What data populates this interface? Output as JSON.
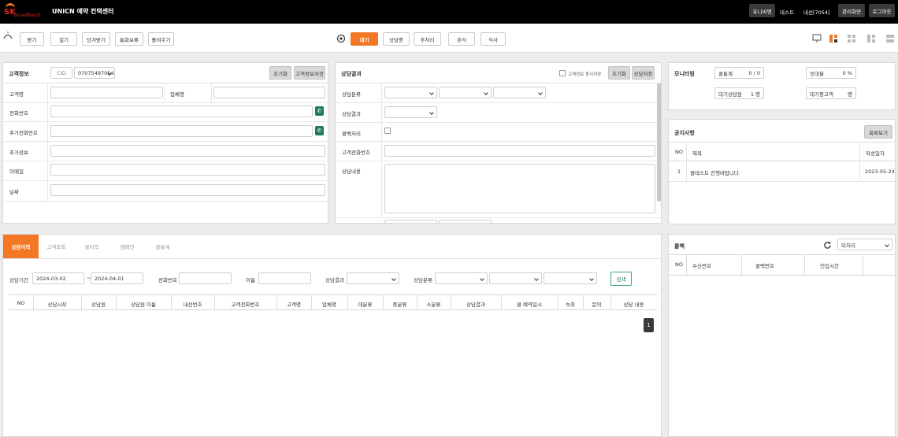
{
  "header": {
    "logo_text": "SK",
    "logo_sub": "broadband",
    "app_title": "UNICN 예약 컨택센터",
    "user_company": "유니씨엔",
    "user_name": "테스트",
    "extension": "내선[7054]",
    "admin_label": "관리화면",
    "logout_label": "로그아웃"
  },
  "toolbar": {
    "left_buttons": [
      "받기",
      "걸기",
      "당겨받기",
      "통화보류",
      "돌려주기"
    ],
    "status_buttons": [
      "대기",
      "상담중",
      "후처리",
      "휴식",
      "식사"
    ],
    "active_status": "대기"
  },
  "customer": {
    "title": "고객정보",
    "cid_label": "CID",
    "cid_value": "07075497054",
    "reset_label": "초기화",
    "save_label": "고객정보저장",
    "fields": {
      "name": "고객명",
      "company": "업체명",
      "phone": "전화번호",
      "extra_phone": "추가전화번호",
      "extra_info": "추가정보",
      "email": "이메일",
      "memo": "날짜"
    }
  },
  "consult": {
    "title": "상담결과",
    "sync_label": "고객정보 동시저장",
    "reset_label": "초기화",
    "save_label": "상담저장",
    "category_label": "상담분류",
    "result_label": "상담결과",
    "callback_label": "콜백처리",
    "customer_phone_label": "고객전화번호",
    "content_label": "상담내용"
  },
  "monitor": {
    "title": "모니터링",
    "call_count_label": "콜통계",
    "call_count_value": "0 / 0",
    "answer_rate_label": "응대율",
    "answer_rate_value": "0 %",
    "waiting_agent_label": "대기상담원",
    "waiting_agent_value": "1 명",
    "waiting_customer_label": "대기중고객",
    "waiting_customer_value": "명"
  },
  "notice": {
    "title": "공지사항",
    "list_button": "목록보기",
    "columns": [
      "NO",
      "제목",
      "작성일자"
    ],
    "rows": [
      {
        "no": "1",
        "title": "콜테스트 진행바랍니다.",
        "date": "2023-05-24"
      }
    ]
  },
  "history": {
    "tabs": [
      "상담이력",
      "고객조회",
      "콜이력",
      "캠페인",
      "콜통계"
    ],
    "active_tab": "상담이력",
    "period_label": "상담기간",
    "date_from": "2024-03-02",
    "date_sep": "~",
    "date_to": "2024-04-01",
    "phone_label": "전화번호",
    "name_label": "이름",
    "result_label": "상담결과",
    "category_label": "상담분류",
    "search_label": "검색",
    "columns": [
      "NO",
      "상담시작",
      "상담원",
      "상담원 이름",
      "내선번호",
      "고객전화번호",
      "고객명",
      "업체명",
      "대분류",
      "중분류",
      "소분류",
      "상담결과",
      "콜 예약일시",
      "녹취",
      "문의",
      "상담 내용"
    ],
    "page": "1"
  },
  "callback": {
    "title": "콜백",
    "filter_value": "미처리",
    "columns": [
      "NO",
      "수신번호",
      "콜백번호",
      "인입시간"
    ]
  },
  "colors": {
    "accent": "#f47725",
    "phone_btn": "#1f7a5a",
    "topbar": "#000000"
  }
}
